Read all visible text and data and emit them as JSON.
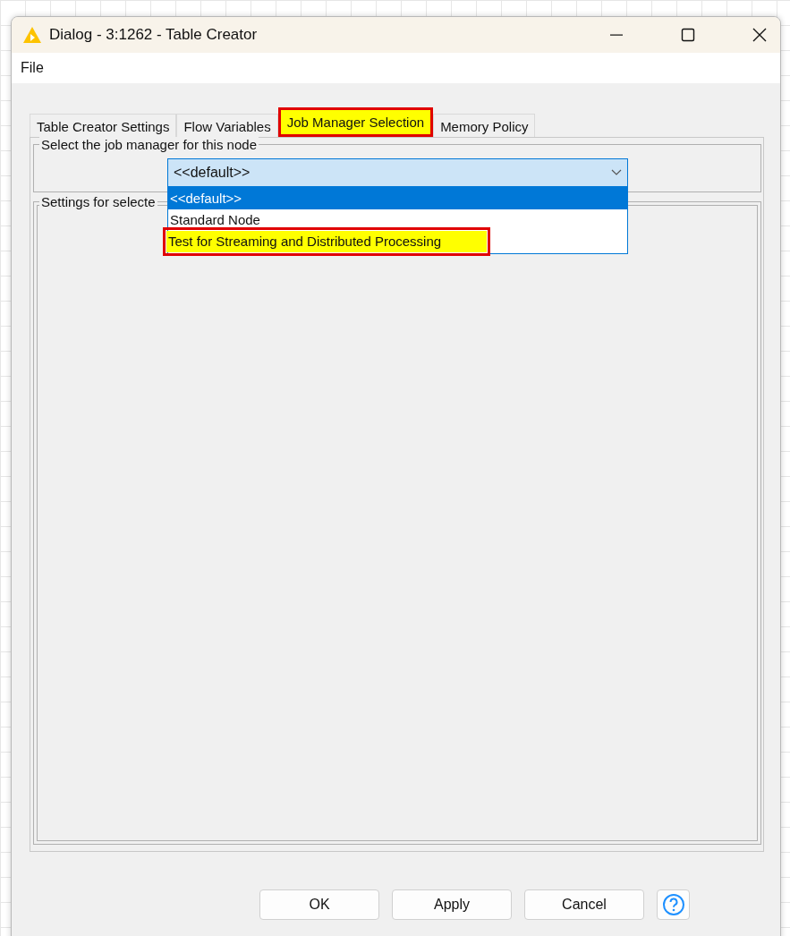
{
  "window": {
    "title": "Dialog - 3:1262 - Table Creator"
  },
  "menu": [
    "File"
  ],
  "tabs": [
    {
      "label": "Table Creator Settings",
      "selected": false,
      "highlighted": false
    },
    {
      "label": "Flow Variables",
      "selected": false,
      "highlighted": false
    },
    {
      "label": "Job Manager Selection",
      "selected": true,
      "highlighted": true
    },
    {
      "label": "Memory Policy",
      "selected": false,
      "highlighted": false
    }
  ],
  "job_manager_group": {
    "title": "Select the job manager for this node",
    "combo": {
      "value": "<<default>>",
      "expanded": true,
      "options": [
        {
          "label": "<<default>>",
          "selected": true,
          "highlighted": false
        },
        {
          "label": "Standard Node",
          "selected": false,
          "highlighted": false
        },
        {
          "label": "Test for Streaming and Distributed Processing",
          "selected": false,
          "highlighted": true
        }
      ]
    }
  },
  "settings_group": {
    "title": "Settings for selecte"
  },
  "buttons": [
    "OK",
    "Apply",
    "Cancel"
  ]
}
